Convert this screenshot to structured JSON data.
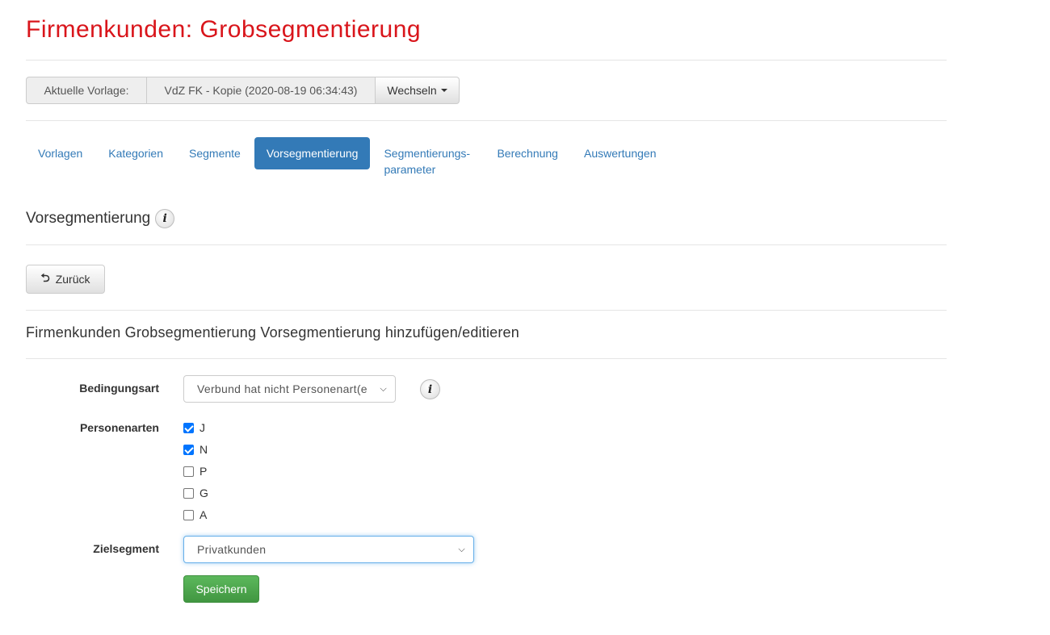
{
  "page": {
    "title": "Firmenkunden: Grobsegmentierung"
  },
  "vorlage": {
    "label": "Aktuelle Vorlage:",
    "value": "VdZ FK - Kopie (2020-08-19 06:34:43)",
    "switch_label": "Wechseln"
  },
  "nav": {
    "items": [
      {
        "label": "Vorlagen"
      },
      {
        "label": "Kategorien"
      },
      {
        "label": "Segmente"
      },
      {
        "label": "Vorsegmentierung",
        "active": true
      },
      {
        "label": "Segmentierungs-parameter"
      },
      {
        "label": "Berechnung"
      },
      {
        "label": "Auswertungen"
      }
    ]
  },
  "section": {
    "title": "Vorsegmentierung",
    "info_icon": "info-icon"
  },
  "back": {
    "label": "Zurück",
    "icon": "return-arrow-icon"
  },
  "form": {
    "title": "Firmenkunden Grobsegmentierung Vorsegmentierung hinzufügen/editieren",
    "bedingungsart": {
      "label": "Bedingungsart",
      "value": "Verbund hat nicht Personenart(e"
    },
    "personenarten": {
      "label": "Personenarten",
      "options": [
        {
          "label": "J",
          "checked": true
        },
        {
          "label": "N",
          "checked": true
        },
        {
          "label": "P",
          "checked": false
        },
        {
          "label": "G",
          "checked": false
        },
        {
          "label": "A",
          "checked": false
        }
      ]
    },
    "zielsegment": {
      "label": "Zielsegment",
      "value": "Privatkunden"
    },
    "save_label": "Speichern"
  },
  "colors": {
    "title_red": "#d9151b",
    "primary": "#337ab7",
    "success": "#5cb85c"
  }
}
